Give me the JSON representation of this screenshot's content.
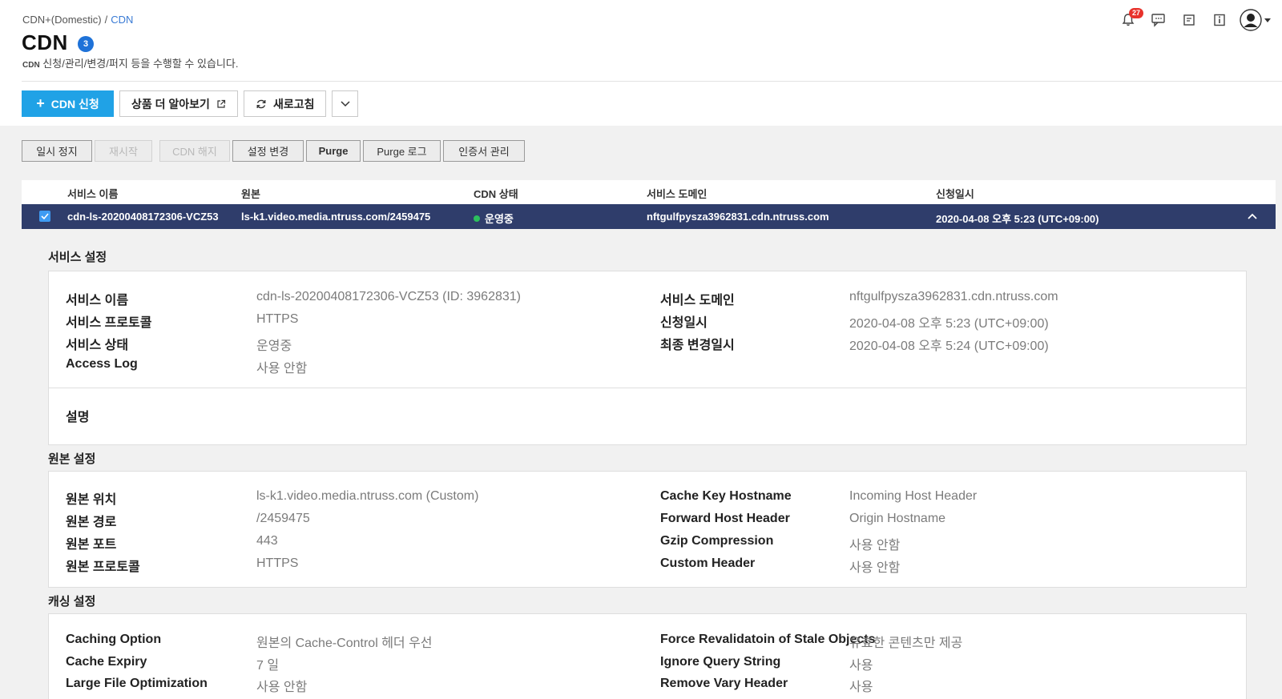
{
  "breadcrumb": {
    "parent": "CDN+(Domestic)",
    "separator": "/",
    "current": "CDN"
  },
  "header": {
    "title": "CDN",
    "title_badge": "3",
    "subtitle_prefix": "CDN",
    "subtitle_rest": " 신청/관리/변경/퍼지 등을 수행할 수 있습니다."
  },
  "top_icons": {
    "notification_count": "27"
  },
  "actions": {
    "apply": "CDN 신청",
    "learn_more": "상품 더 알아보기",
    "refresh": "새로고침"
  },
  "toolbar": [
    {
      "label": "일시 정지",
      "disabled": false,
      "bold": false
    },
    {
      "label": "재시작",
      "disabled": true,
      "bold": false
    },
    {
      "label": "CDN 해지",
      "disabled": true,
      "bold": false
    },
    {
      "label": "설정 변경",
      "disabled": false,
      "bold": false
    },
    {
      "label": "Purge",
      "disabled": false,
      "bold": true
    },
    {
      "label": "Purge 로그",
      "disabled": false,
      "bold": false
    },
    {
      "label": "인증서 관리",
      "disabled": false,
      "bold": false
    }
  ],
  "table": {
    "headers": {
      "name": "서비스 이름",
      "origin": "원본",
      "status": "CDN 상태",
      "domain": "서비스 도메인",
      "date": "신청일시"
    },
    "row": {
      "name": "cdn-ls-20200408172306-VCZ53",
      "origin": "ls-k1.video.media.ntruss.com/2459475",
      "status": "운영중",
      "domain": "nftgulfpysza3962831.cdn.ntruss.com",
      "date": "2020-04-08 오후 5:23 (UTC+09:00)"
    }
  },
  "service_settings": {
    "title": "서비스 설정",
    "left": [
      {
        "k": "서비스 이름",
        "v": "cdn-ls-20200408172306-VCZ53 (ID: 3962831)"
      },
      {
        "k": "서비스 프로토콜",
        "v": "HTTPS"
      },
      {
        "k": "서비스 상태",
        "v": "운영중"
      },
      {
        "k": "Access Log",
        "v": "사용 안함"
      }
    ],
    "right": [
      {
        "k": "서비스 도메인",
        "v": "nftgulfpysza3962831.cdn.ntruss.com"
      },
      {
        "k": "신청일시",
        "v": "2020-04-08 오후 5:23 (UTC+09:00)"
      },
      {
        "k": "최종 변경일시",
        "v": "2020-04-08 오후 5:24 (UTC+09:00)"
      }
    ],
    "description_label": "설명"
  },
  "origin_settings": {
    "title": "원본 설정",
    "left": [
      {
        "k": "원본 위치",
        "v": "ls-k1.video.media.ntruss.com (Custom)"
      },
      {
        "k": "원본 경로",
        "v": "/2459475"
      },
      {
        "k": "원본 포트",
        "v": "443"
      },
      {
        "k": "원본 프로토콜",
        "v": "HTTPS"
      }
    ],
    "right": [
      {
        "k": "Cache Key Hostname",
        "v": "Incoming Host Header"
      },
      {
        "k": "Forward Host Header",
        "v": "Origin Hostname"
      },
      {
        "k": "Gzip Compression",
        "v": "사용 안함"
      },
      {
        "k": "Custom Header",
        "v": "사용 안함"
      }
    ]
  },
  "caching_settings": {
    "title": "캐싱 설정",
    "left": [
      {
        "k": "Caching Option",
        "v": "원본의 Cache-Control 헤더 우선"
      },
      {
        "k": "Cache Expiry",
        "v": "7 일"
      },
      {
        "k": "Large File Optimization",
        "v": "사용 안함"
      }
    ],
    "right": [
      {
        "k": "Force Revalidatoin of Stale Objects",
        "v": "유효한 콘텐츠만 제공"
      },
      {
        "k": "Ignore Query String",
        "v": "사용"
      },
      {
        "k": "Remove Vary Header",
        "v": "사용"
      }
    ]
  }
}
